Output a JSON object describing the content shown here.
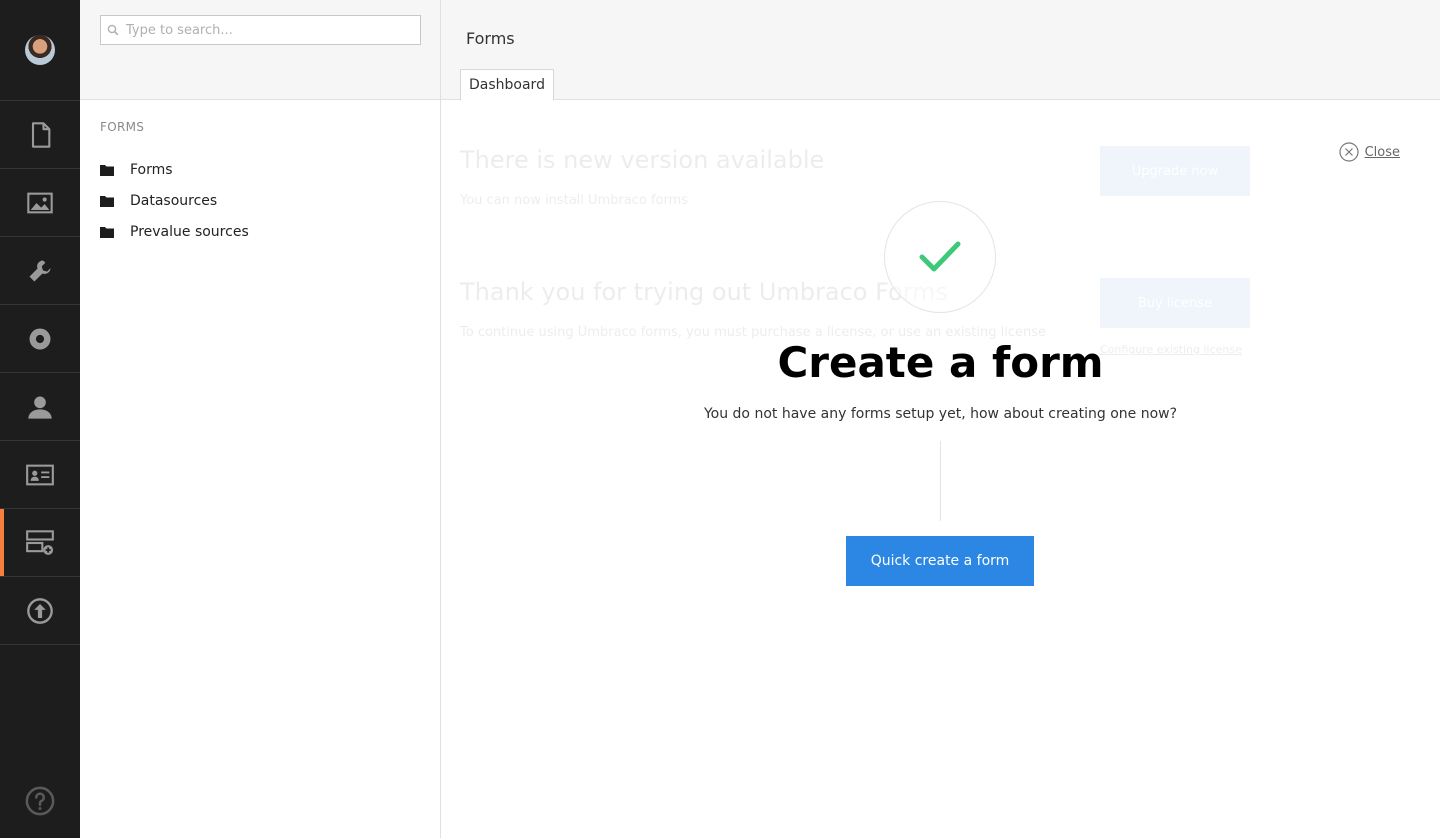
{
  "search": {
    "placeholder": "Type to search..."
  },
  "tree": {
    "section_label": "FORMS",
    "items": [
      {
        "label": "Forms",
        "icon": "folder-icon"
      },
      {
        "label": "Datasources",
        "icon": "folder-icon"
      },
      {
        "label": "Prevalue sources",
        "icon": "folder-icon"
      }
    ]
  },
  "rail": {
    "items": [
      "content-icon",
      "media-icon",
      "settings-wrench-icon",
      "gear-icon",
      "user-icon",
      "member-card-icon",
      "forms-icon",
      "upload-icon"
    ],
    "active": "forms-icon",
    "help_icon": "help-icon",
    "accent_color": "#f5803b"
  },
  "header": {
    "title": "Forms",
    "tabs": [
      {
        "label": "Dashboard"
      }
    ]
  },
  "background": {
    "upgrade_title": "There is new version available",
    "upgrade_text": "You can now install Umbraco forms",
    "upgrade_button": "Upgrade now",
    "trial_title": "Thank you for trying out Umbraco Forms",
    "trial_text": "To continue using Umbraco forms, you must purchase a license, or use an existing license",
    "trial_button": "Buy license",
    "trial_link": "Configure existing license"
  },
  "close": {
    "label": "Close"
  },
  "empty_state": {
    "title": "Create a form",
    "text": "You do not have any forms setup yet, how about creating one now?",
    "button": "Quick create a form",
    "button_color": "#2b87e3",
    "check_color": "#3ec97a"
  }
}
